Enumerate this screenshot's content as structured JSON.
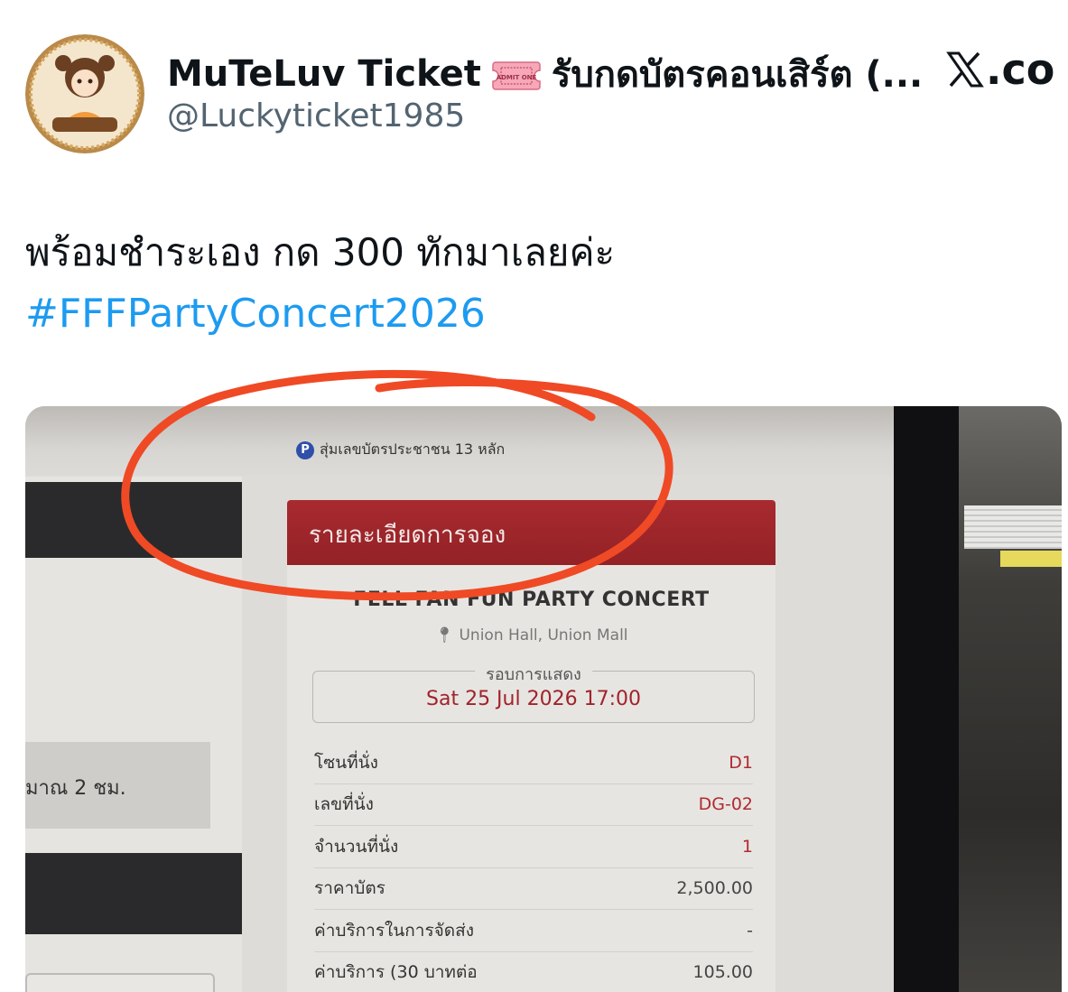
{
  "tweet": {
    "display_name": "MuTeLuv Ticket",
    "display_name_suffix": "รับกดบัตรคอนเสิร์ต (...",
    "handle": "@Luckyticket1985",
    "brand": ".co",
    "text": "พร้อมชำระเอง กด 300 ทักมาเลยค่ะ",
    "hashtag": "#FFFPartyConcert2026",
    "avatar_caption": "MuTeLuv Ticket",
    "ticket_emoji_text": "ADMIT ONE"
  },
  "photo": {
    "hint_badge": "P",
    "hint_text": "สุ่มเลขบัตรประชาชน 13 หลัก",
    "left_panel_text": "มาณ 2 ชม.",
    "card": {
      "header": "รายละเอียดการจอง",
      "event_name": "FELL FAN FUN PARTY CONCERT",
      "venue": "Union Hall, Union Mall",
      "show_label": "รอบการแสดง",
      "show_datetime": "Sat 25 Jul 2026 17:00",
      "rows": [
        {
          "label": "โซนที่นั่ง",
          "value": "D1"
        },
        {
          "label": "เลขที่นั่ง",
          "value": "DG-02"
        },
        {
          "label": "จำนวนที่นั่ง",
          "value": "1"
        },
        {
          "label": "ราคาบัตร",
          "value": "2,500.00"
        },
        {
          "label": "ค่าบริการในการจัดส่ง",
          "value": "-"
        },
        {
          "label": "ค่าบริการ (30 บาทต่อ",
          "value": "105.00"
        }
      ]
    }
  },
  "colors": {
    "hashtag": "#1d9bf0",
    "annotation_circle": "#ef4a25",
    "card_header": "#a82a2f",
    "handle": "#536471"
  }
}
